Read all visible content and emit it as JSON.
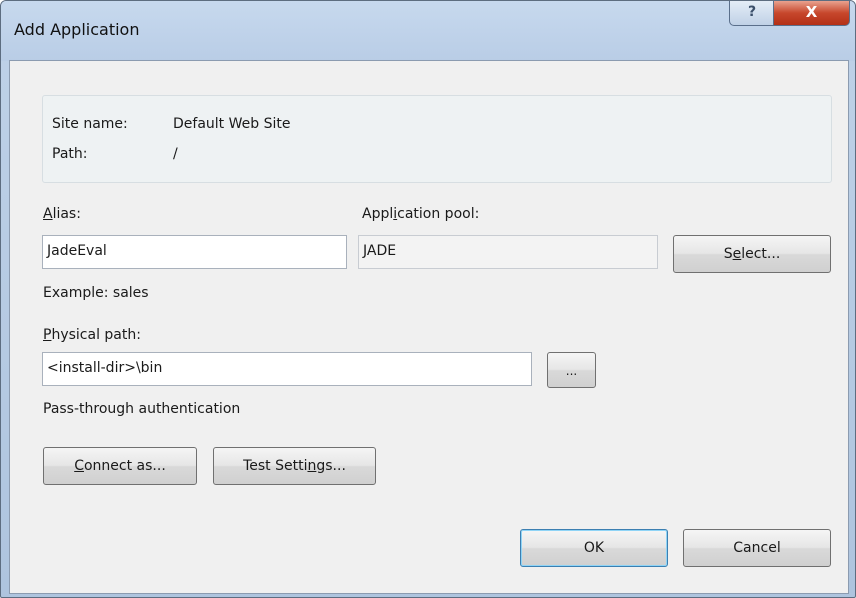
{
  "window": {
    "title": "Add Application",
    "help_glyph": "?",
    "close_glyph": "X"
  },
  "site_info": {
    "site_name_label": "Site name:",
    "site_name_value": "Default Web Site",
    "path_label": "Path:",
    "path_value": "/"
  },
  "alias": {
    "label_mnemonic": "A",
    "label_rest": "lias:",
    "value": "JadeEval",
    "example": "Example: sales"
  },
  "app_pool": {
    "label_pre": "Appl",
    "label_mnemonic": "i",
    "label_post": "cation pool:",
    "value": "JADE",
    "select_pre": "S",
    "select_mnemonic": "e",
    "select_post": "lect..."
  },
  "physical_path": {
    "label_mnemonic": "P",
    "label_rest": "hysical path:",
    "value": "<install-dir>\\bin",
    "browse_label": "..."
  },
  "auth": {
    "text": "Pass-through authentication"
  },
  "buttons": {
    "connect_mnemonic": "C",
    "connect_rest": "onnect as...",
    "test_pre": "Test Setti",
    "test_mnemonic": "n",
    "test_post": "gs...",
    "ok": "OK",
    "cancel": "Cancel"
  }
}
